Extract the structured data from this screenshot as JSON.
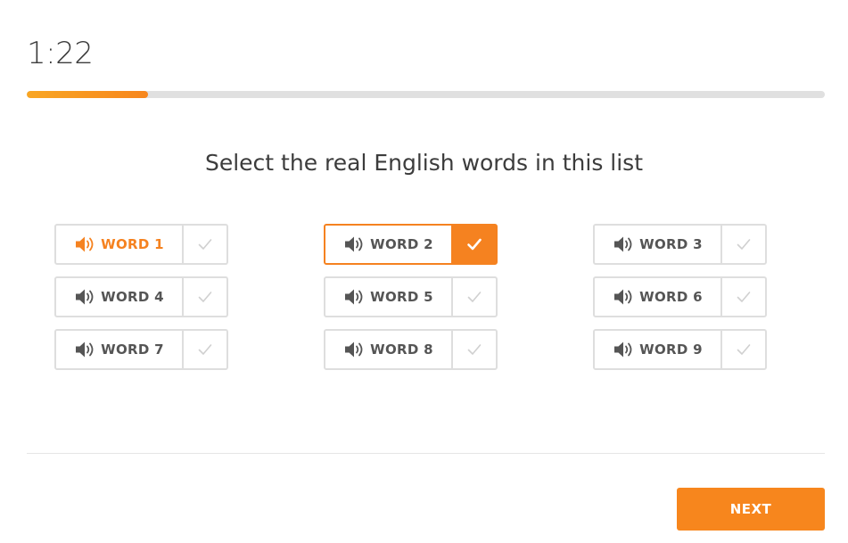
{
  "timer": {
    "value": "1:22"
  },
  "progress": {
    "fraction": 0.152
  },
  "prompt": {
    "text": "Select the real English words in this list"
  },
  "words": [
    {
      "label": "WORD 1",
      "playing": true,
      "selected": false
    },
    {
      "label": "WORD 2",
      "playing": false,
      "selected": true
    },
    {
      "label": "WORD 3",
      "playing": false,
      "selected": false
    },
    {
      "label": "WORD 4",
      "playing": false,
      "selected": false
    },
    {
      "label": "WORD 5",
      "playing": false,
      "selected": false
    },
    {
      "label": "WORD 6",
      "playing": false,
      "selected": false
    },
    {
      "label": "WORD 7",
      "playing": false,
      "selected": false
    },
    {
      "label": "WORD 8",
      "playing": false,
      "selected": false
    },
    {
      "label": "WORD 9",
      "playing": false,
      "selected": false
    }
  ],
  "icons": {
    "speaker": "speaker-icon",
    "check": "check-icon"
  },
  "footer": {
    "next_label": "NEXT"
  },
  "colors": {
    "accent": "#f7861d",
    "accent_border": "#f58220",
    "speaker_active": "#f58220",
    "speaker_idle": "#555555",
    "check_idle": "#d0d0d0",
    "check_selected": "#ffffff",
    "progress_track": "#e0e0e0"
  }
}
